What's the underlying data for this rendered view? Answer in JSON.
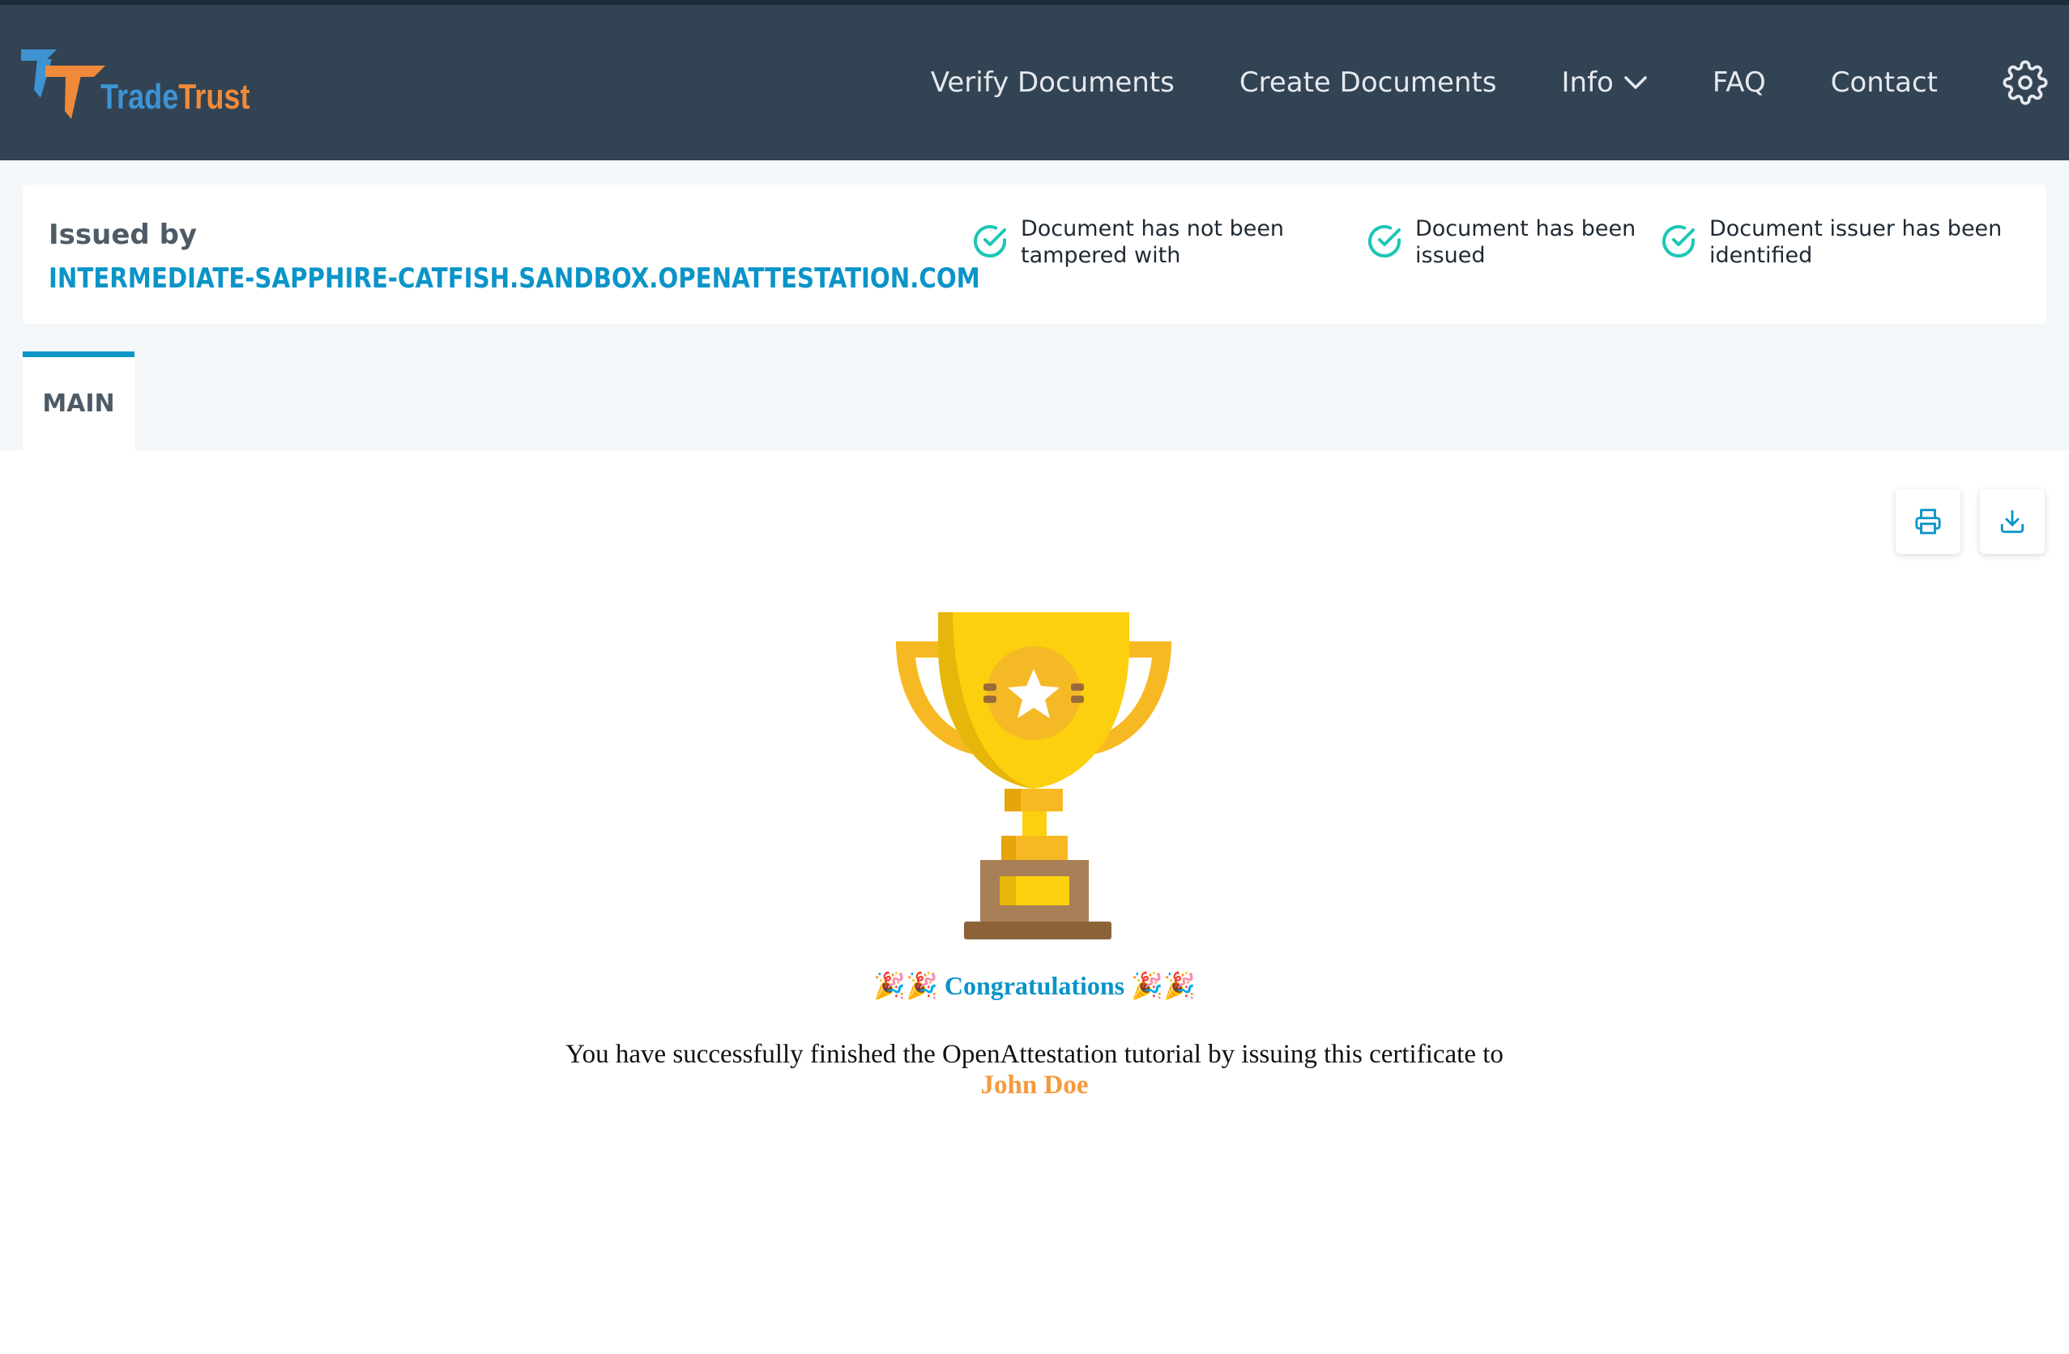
{
  "nav": {
    "logo_word_1": "Trade",
    "logo_word_2": "Trust",
    "links": [
      "Verify Documents",
      "Create Documents",
      "Info",
      "FAQ",
      "Contact"
    ],
    "settings_icon": "gear-icon",
    "info_icon": "chevron-down-icon"
  },
  "status": {
    "issued_by_label": "Issued by",
    "issuer_domain": "INTERMEDIATE-SAPPHIRE-CATFISH.SANDBOX.OPENATTESTATION.COM",
    "checks": [
      {
        "text": "Document has not been tampered with"
      },
      {
        "text": "Document has been issued"
      },
      {
        "text": "Document issuer has been identified"
      }
    ],
    "check_icon": "check-circle-icon"
  },
  "tabs": [
    {
      "label": "MAIN",
      "active": true
    }
  ],
  "actions": {
    "print_icon": "printer-icon",
    "download_icon": "download-icon"
  },
  "certificate": {
    "emoji": "🎉🎉",
    "congrats": "Congratulations",
    "message": "You have successfully finished the OpenAttestation tutorial by issuing this certificate to",
    "recipient": "John Doe"
  },
  "colors": {
    "navbar": "#324353",
    "accent": "#0a94c8",
    "check": "#1cc7b4",
    "logo_orange": "#f08a3a",
    "logo_blue": "#3e93d2",
    "recipient": "#f59a3c"
  }
}
